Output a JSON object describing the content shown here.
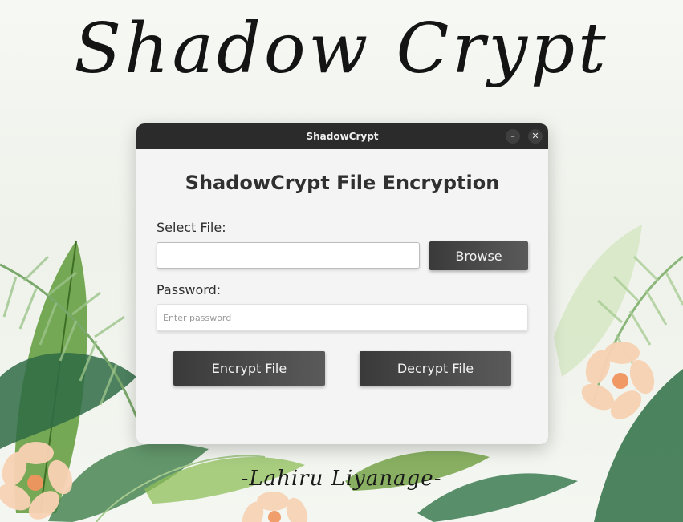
{
  "banner": {
    "title": "Shadow Crypt",
    "signature": "-Lahiru Liyanage-"
  },
  "window": {
    "title": "ShadowCrypt",
    "minimize_symbol": "–",
    "close_symbol": "✕"
  },
  "app": {
    "heading": "ShadowCrypt File Encryption",
    "file_label": "Select File:",
    "file_value": "",
    "browse_label": "Browse",
    "password_label": "Password:",
    "password_placeholder": "Enter password",
    "encrypt_label": "Encrypt File",
    "decrypt_label": "Decrypt File"
  },
  "colors": {
    "titlebar": "#2b2b2b",
    "window_bg": "#f4f4f4",
    "button_dark": "#3a3a3a",
    "leaf_green": "#4f8a3c",
    "flower_peach": "#f7c9a8"
  }
}
